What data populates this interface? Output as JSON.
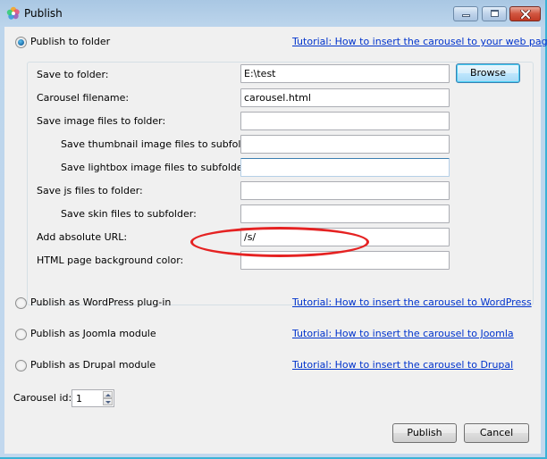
{
  "window": {
    "title": "Publish",
    "controls": {
      "minimize": "minimize",
      "maximize": "maximize",
      "close": "close"
    }
  },
  "options": [
    {
      "label": "Publish to folder",
      "checked": true,
      "tutorial": "Tutorial: How to insert the carousel to your web page"
    },
    {
      "label": "Publish as WordPress plug-in",
      "checked": false,
      "tutorial": "Tutorial: How to insert the carousel to WordPress"
    },
    {
      "label": "Publish as Joomla module",
      "checked": false,
      "tutorial": "Tutorial: How to insert the carousel to Joomla"
    },
    {
      "label": "Publish as Drupal module",
      "checked": false,
      "tutorial": "Tutorial: How to insert the carousel to Drupal"
    }
  ],
  "folder_settings": {
    "fields": [
      {
        "label": "Save to folder:",
        "value": "E:\\test"
      },
      {
        "label": "Carousel filename:",
        "value": "carousel.html"
      },
      {
        "label": "Save image files to folder:",
        "value": ""
      },
      {
        "label": "Save thumbnail image files to subfolder:",
        "value": ""
      },
      {
        "label": "Save lightbox image files to subfolder:",
        "value": ""
      },
      {
        "label": "Save js files to folder:",
        "value": ""
      },
      {
        "label": "Save skin files to subfolder:",
        "value": ""
      },
      {
        "label": "Add absolute URL:",
        "value": "/s/"
      },
      {
        "label": "HTML page background color:",
        "value": ""
      }
    ],
    "browse_label": "Browse"
  },
  "carousel_id": {
    "label": "Carousel id:",
    "value": "1"
  },
  "footer": {
    "publish_label": "Publish",
    "cancel_label": "Cancel"
  },
  "annotation": {
    "color": "#e52222",
    "highlights": "Add absolute URL"
  }
}
